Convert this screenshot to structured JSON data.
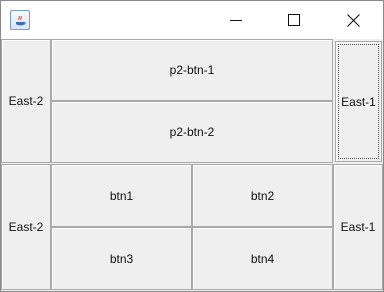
{
  "window": {
    "title": "",
    "controls": {
      "minimize_icon": "minimize-icon",
      "maximize_icon": "maximize-icon",
      "close_icon": "close-icon"
    }
  },
  "panel_top": {
    "west_label": "East-2",
    "center_buttons": [
      "p2-btn-1",
      "p2-btn-2"
    ],
    "east_label": "East-1"
  },
  "panel_bottom": {
    "west_label": "East-2",
    "grid_buttons": [
      "btn1",
      "btn2",
      "btn3",
      "btn4"
    ],
    "east_label": "East-1"
  },
  "colors": {
    "panel_bg": "#f0f0f0",
    "button_bg": "#efefef",
    "border": "#a9a9a9"
  }
}
